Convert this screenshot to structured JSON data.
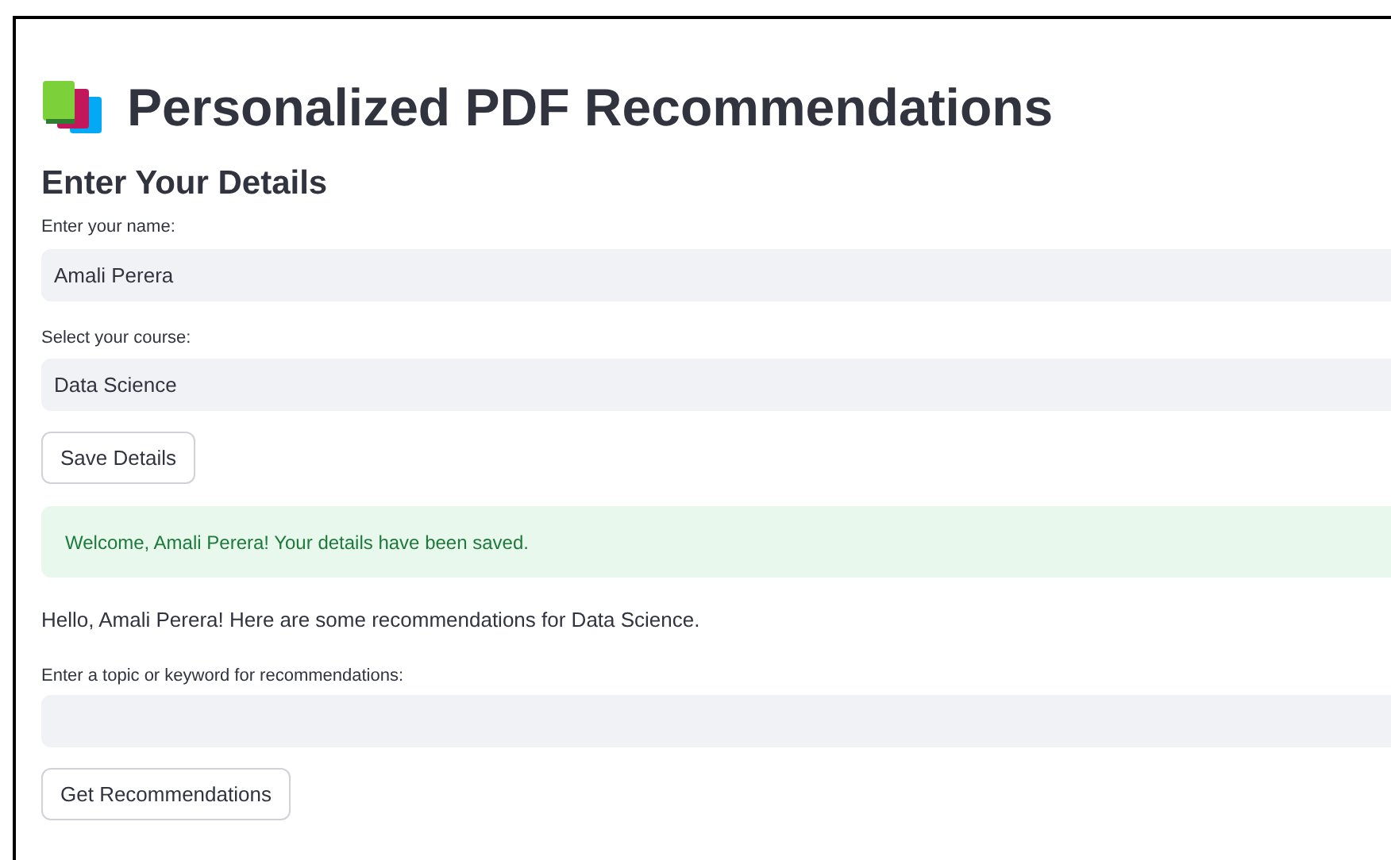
{
  "title": "Personalized PDF Recommendations",
  "section_heading": "Enter Your Details",
  "name_field": {
    "label": "Enter your name:",
    "value": "Amali Perera"
  },
  "course_select": {
    "label": "Select your course:",
    "value": "Data Science"
  },
  "save_button": "Save Details",
  "success_message": "Welcome, Amali Perera! Your details have been saved.",
  "greeting": "Hello, Amali Perera! Here are some recommendations for Data Science.",
  "topic_field": {
    "label": "Enter a topic or keyword for recommendations:"
  },
  "recommend_button": "Get Recommendations"
}
